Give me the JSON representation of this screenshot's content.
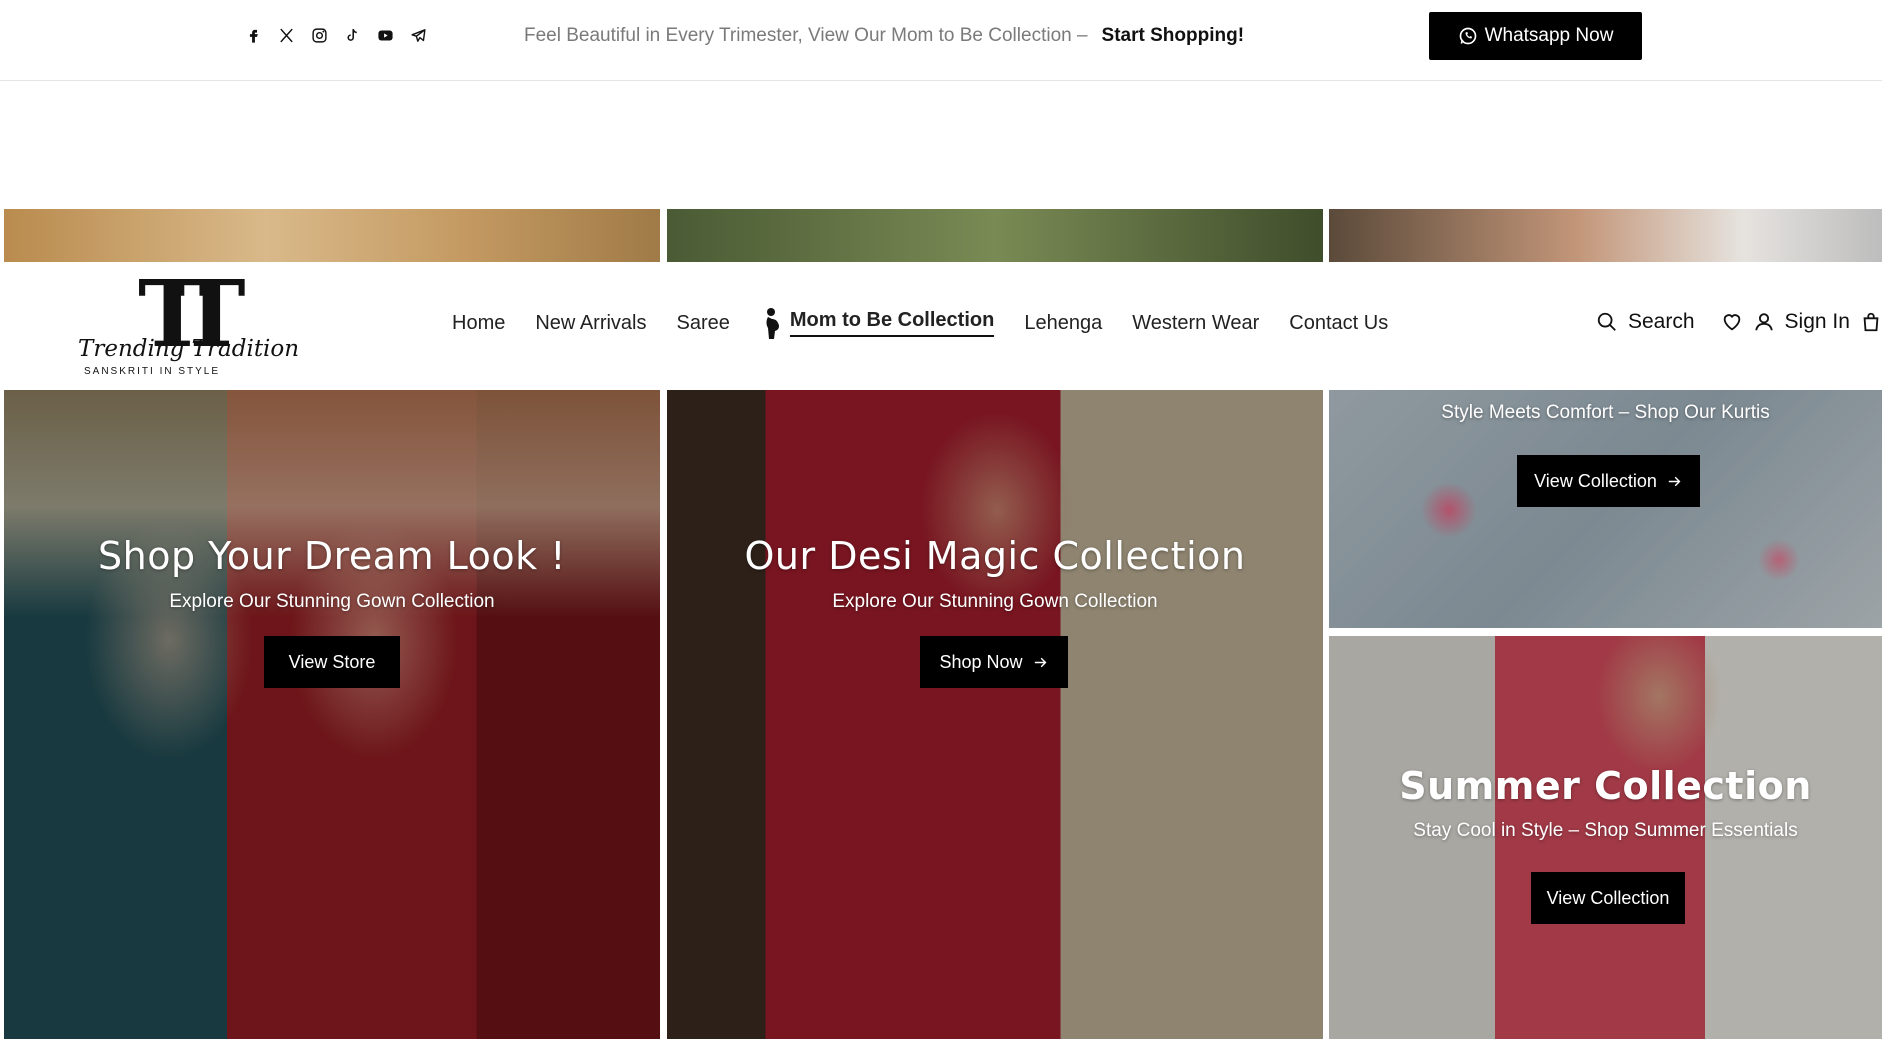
{
  "topbar": {
    "socials": [
      {
        "name": "facebook-icon"
      },
      {
        "name": "x-icon"
      },
      {
        "name": "instagram-icon"
      },
      {
        "name": "tiktok-icon"
      },
      {
        "name": "youtube-icon"
      },
      {
        "name": "telegram-icon"
      }
    ],
    "announcement_text": "Feel Beautiful in Every Trimester, View Our Mom to Be Collection –",
    "announcement_cta": "Start Shopping!",
    "whatsapp_label": "Whatsapp Now"
  },
  "header": {
    "logo": {
      "mark": "TT",
      "script": "Trending Tradition",
      "tagline": "SANSKRITI IN STYLE"
    },
    "nav": [
      {
        "label": "Home"
      },
      {
        "label": "New Arrivals"
      },
      {
        "label": "Saree"
      },
      {
        "label": "Mom to Be Collection",
        "active": true
      },
      {
        "label": "Lehenga"
      },
      {
        "label": "Western Wear"
      },
      {
        "label": "Contact Us"
      }
    ],
    "search_label": "Search",
    "signin_label": "Sign In"
  },
  "banners": {
    "left": {
      "title": "Shop Your Dream Look !",
      "subtitle": "Explore Our Stunning Gown Collection",
      "button": "View Store"
    },
    "center": {
      "title": "Our Desi Magic Collection",
      "subtitle": "Explore Our Stunning Gown Collection",
      "button": "Shop Now"
    },
    "right_top": {
      "subtitle": "Style Meets Comfort – Shop Our Kurtis",
      "button": "View Collection"
    },
    "right_bottom": {
      "title": "Summer Collection",
      "subtitle": "Stay Cool in Style – Shop Summer Essentials",
      "button": "View Collection"
    }
  },
  "colors": {
    "accent": "#000000",
    "text": "#222222",
    "muted": "#7a7a7a"
  }
}
